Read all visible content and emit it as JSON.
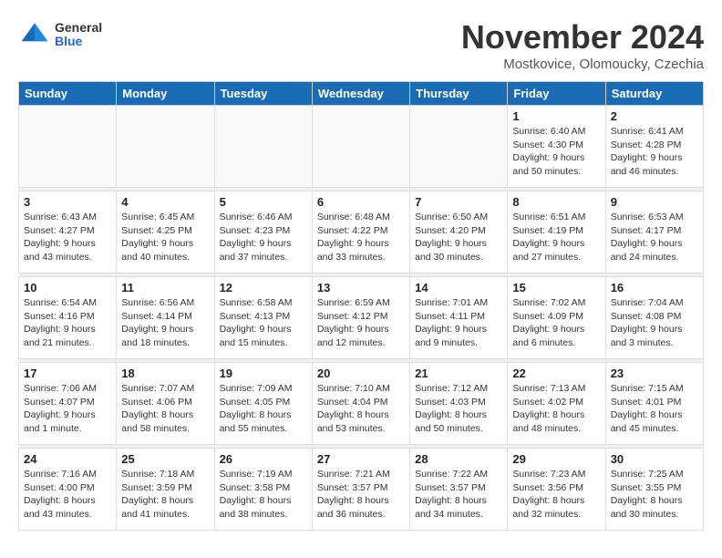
{
  "logo": {
    "general": "General",
    "blue": "Blue"
  },
  "title": "November 2024",
  "subtitle": "Mostkovice, Olomoucky, Czechia",
  "days_header": [
    "Sunday",
    "Monday",
    "Tuesday",
    "Wednesday",
    "Thursday",
    "Friday",
    "Saturday"
  ],
  "weeks": [
    [
      {
        "day": "",
        "info": ""
      },
      {
        "day": "",
        "info": ""
      },
      {
        "day": "",
        "info": ""
      },
      {
        "day": "",
        "info": ""
      },
      {
        "day": "",
        "info": ""
      },
      {
        "day": "1",
        "info": "Sunrise: 6:40 AM\nSunset: 4:30 PM\nDaylight: 9 hours\nand 50 minutes."
      },
      {
        "day": "2",
        "info": "Sunrise: 6:41 AM\nSunset: 4:28 PM\nDaylight: 9 hours\nand 46 minutes."
      }
    ],
    [
      {
        "day": "3",
        "info": "Sunrise: 6:43 AM\nSunset: 4:27 PM\nDaylight: 9 hours\nand 43 minutes."
      },
      {
        "day": "4",
        "info": "Sunrise: 6:45 AM\nSunset: 4:25 PM\nDaylight: 9 hours\nand 40 minutes."
      },
      {
        "day": "5",
        "info": "Sunrise: 6:46 AM\nSunset: 4:23 PM\nDaylight: 9 hours\nand 37 minutes."
      },
      {
        "day": "6",
        "info": "Sunrise: 6:48 AM\nSunset: 4:22 PM\nDaylight: 9 hours\nand 33 minutes."
      },
      {
        "day": "7",
        "info": "Sunrise: 6:50 AM\nSunset: 4:20 PM\nDaylight: 9 hours\nand 30 minutes."
      },
      {
        "day": "8",
        "info": "Sunrise: 6:51 AM\nSunset: 4:19 PM\nDaylight: 9 hours\nand 27 minutes."
      },
      {
        "day": "9",
        "info": "Sunrise: 6:53 AM\nSunset: 4:17 PM\nDaylight: 9 hours\nand 24 minutes."
      }
    ],
    [
      {
        "day": "10",
        "info": "Sunrise: 6:54 AM\nSunset: 4:16 PM\nDaylight: 9 hours\nand 21 minutes."
      },
      {
        "day": "11",
        "info": "Sunrise: 6:56 AM\nSunset: 4:14 PM\nDaylight: 9 hours\nand 18 minutes."
      },
      {
        "day": "12",
        "info": "Sunrise: 6:58 AM\nSunset: 4:13 PM\nDaylight: 9 hours\nand 15 minutes."
      },
      {
        "day": "13",
        "info": "Sunrise: 6:59 AM\nSunset: 4:12 PM\nDaylight: 9 hours\nand 12 minutes."
      },
      {
        "day": "14",
        "info": "Sunrise: 7:01 AM\nSunset: 4:11 PM\nDaylight: 9 hours\nand 9 minutes."
      },
      {
        "day": "15",
        "info": "Sunrise: 7:02 AM\nSunset: 4:09 PM\nDaylight: 9 hours\nand 6 minutes."
      },
      {
        "day": "16",
        "info": "Sunrise: 7:04 AM\nSunset: 4:08 PM\nDaylight: 9 hours\nand 3 minutes."
      }
    ],
    [
      {
        "day": "17",
        "info": "Sunrise: 7:06 AM\nSunset: 4:07 PM\nDaylight: 9 hours\nand 1 minute."
      },
      {
        "day": "18",
        "info": "Sunrise: 7:07 AM\nSunset: 4:06 PM\nDaylight: 8 hours\nand 58 minutes."
      },
      {
        "day": "19",
        "info": "Sunrise: 7:09 AM\nSunset: 4:05 PM\nDaylight: 8 hours\nand 55 minutes."
      },
      {
        "day": "20",
        "info": "Sunrise: 7:10 AM\nSunset: 4:04 PM\nDaylight: 8 hours\nand 53 minutes."
      },
      {
        "day": "21",
        "info": "Sunrise: 7:12 AM\nSunset: 4:03 PM\nDaylight: 8 hours\nand 50 minutes."
      },
      {
        "day": "22",
        "info": "Sunrise: 7:13 AM\nSunset: 4:02 PM\nDaylight: 8 hours\nand 48 minutes."
      },
      {
        "day": "23",
        "info": "Sunrise: 7:15 AM\nSunset: 4:01 PM\nDaylight: 8 hours\nand 45 minutes."
      }
    ],
    [
      {
        "day": "24",
        "info": "Sunrise: 7:16 AM\nSunset: 4:00 PM\nDaylight: 8 hours\nand 43 minutes."
      },
      {
        "day": "25",
        "info": "Sunrise: 7:18 AM\nSunset: 3:59 PM\nDaylight: 8 hours\nand 41 minutes."
      },
      {
        "day": "26",
        "info": "Sunrise: 7:19 AM\nSunset: 3:58 PM\nDaylight: 8 hours\nand 38 minutes."
      },
      {
        "day": "27",
        "info": "Sunrise: 7:21 AM\nSunset: 3:57 PM\nDaylight: 8 hours\nand 36 minutes."
      },
      {
        "day": "28",
        "info": "Sunrise: 7:22 AM\nSunset: 3:57 PM\nDaylight: 8 hours\nand 34 minutes."
      },
      {
        "day": "29",
        "info": "Sunrise: 7:23 AM\nSunset: 3:56 PM\nDaylight: 8 hours\nand 32 minutes."
      },
      {
        "day": "30",
        "info": "Sunrise: 7:25 AM\nSunset: 3:55 PM\nDaylight: 8 hours\nand 30 minutes."
      }
    ]
  ]
}
